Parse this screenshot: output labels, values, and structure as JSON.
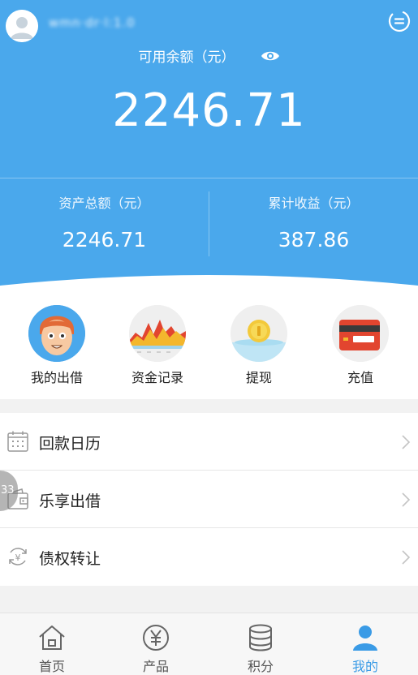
{
  "header": {
    "username": "wmn·dr·l:1.0",
    "available_label": "可用余额（元）",
    "balance": "2246.71",
    "total_assets_label": "资产总额（元）",
    "total_assets": "2246.71",
    "cumulative_income_label": "累计收益（元）",
    "cumulative_income": "387.86",
    "icons": {
      "avatar": "user-avatar-icon",
      "message": "message-icon",
      "visibility": "eye-icon"
    },
    "colors": {
      "primary": "#4aa8ec"
    }
  },
  "quick_actions": [
    {
      "label": "我的出借",
      "icon": "face-icon"
    },
    {
      "label": "资金记录",
      "icon": "chart-icon"
    },
    {
      "label": "提现",
      "icon": "coin-icon"
    },
    {
      "label": "充值",
      "icon": "card-icon"
    }
  ],
  "menu": [
    {
      "label": "回款日历",
      "icon": "calendar-icon"
    },
    {
      "label": "乐享出借",
      "icon": "wallet-icon"
    },
    {
      "label": "债权转让",
      "icon": "yen-transfer-icon"
    }
  ],
  "side_bubble": "33",
  "tabbar": {
    "active_color": "#3a9be6",
    "tabs": [
      {
        "label": "首页",
        "icon": "home-icon"
      },
      {
        "label": "产品",
        "icon": "yen-icon"
      },
      {
        "label": "积分",
        "icon": "coins-stack-icon"
      },
      {
        "label": "我的",
        "icon": "person-icon",
        "active": true
      }
    ]
  }
}
